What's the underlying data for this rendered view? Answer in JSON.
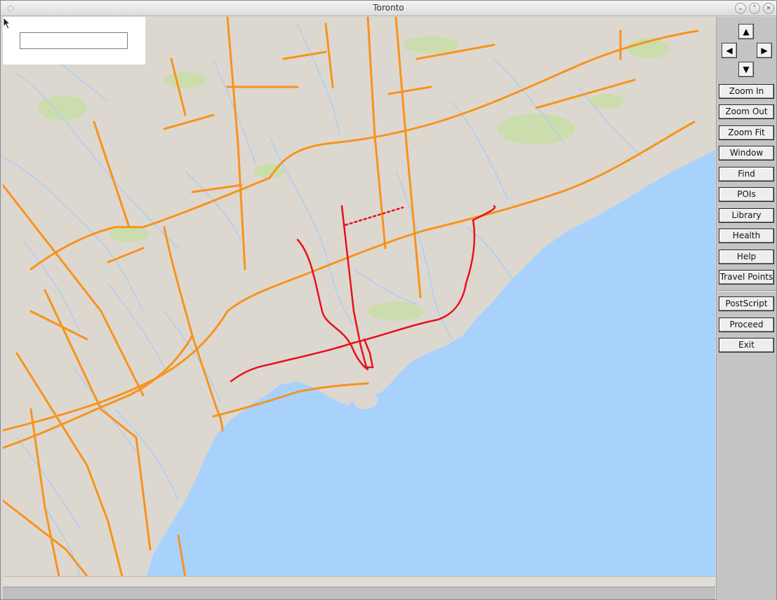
{
  "window": {
    "title": "Toronto",
    "controls": [
      "minimize",
      "maximize",
      "close"
    ]
  },
  "search": {
    "value": "",
    "placeholder": ""
  },
  "navigation": {
    "up_icon": "arrow-up-icon",
    "left_icon": "arrow-left-icon",
    "right_icon": "arrow-right-icon",
    "down_icon": "arrow-down-icon"
  },
  "buttons": {
    "zoom_in": "Zoom In",
    "zoom_out": "Zoom Out",
    "zoom_fit": "Zoom Fit",
    "window": "Window",
    "find": "Find",
    "pois": "POIs",
    "library": "Library",
    "health": "Health",
    "help": "Help",
    "travel_points": "Travel Points",
    "postscript": "PostScript",
    "proceed": "Proceed",
    "exit": "Exit"
  },
  "colors": {
    "land": "#ddd8cf",
    "water": "#a8d2fb",
    "rivers": "#a9cdf6",
    "highways": "#f7931e",
    "route": "#e8101c",
    "parks": "#c8dfa4"
  }
}
